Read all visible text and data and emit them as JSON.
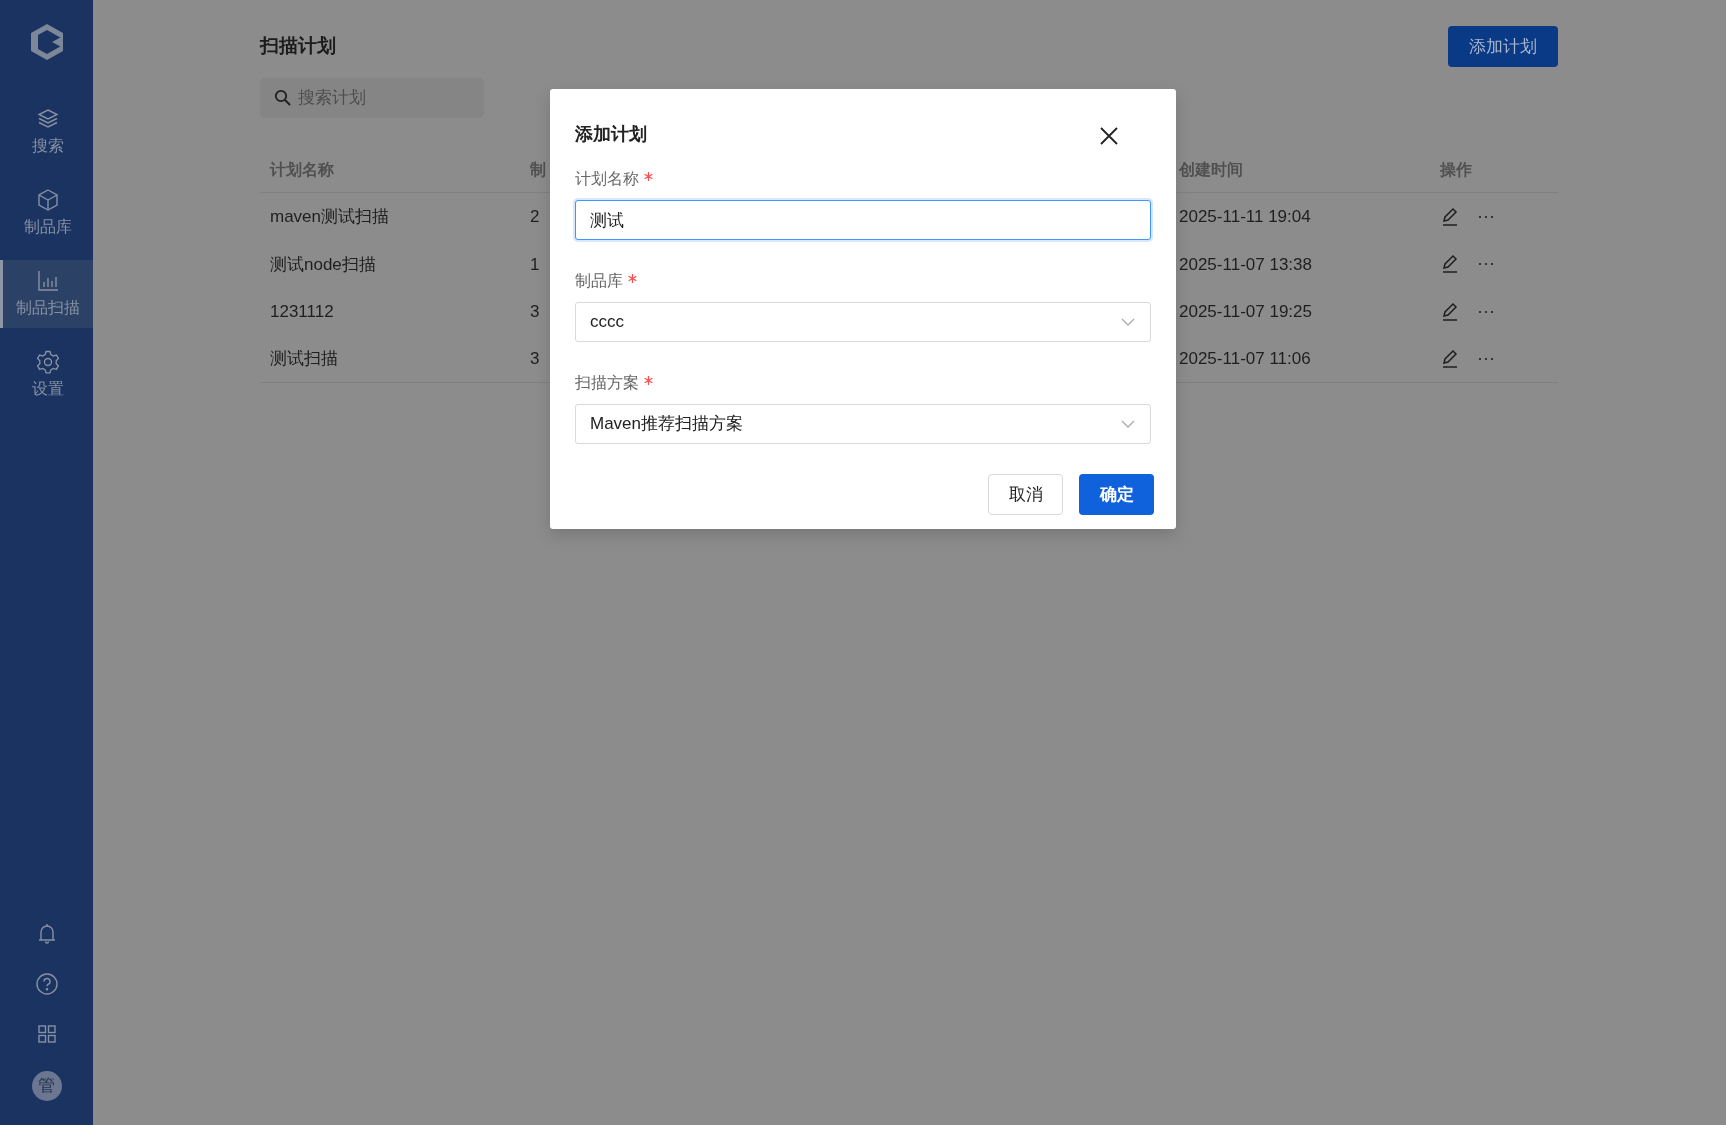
{
  "sidebar": {
    "items": [
      {
        "label": "搜索",
        "selected": false
      },
      {
        "label": "制品库",
        "selected": false
      },
      {
        "label": "制品扫描",
        "selected": true
      },
      {
        "label": "设置",
        "selected": false
      }
    ],
    "avatar": "管"
  },
  "page": {
    "title": "扫描计划",
    "add_button": "添加计划",
    "search": {
      "placeholder": "搜索计划"
    }
  },
  "table": {
    "columns": [
      "计划名称",
      "制",
      "创建时间",
      "操作"
    ],
    "rows": [
      {
        "name": "maven测试扫描",
        "column_2": "2",
        "created": "2025-11-11 19:04"
      },
      {
        "name": "测试node扫描",
        "column_2": "1",
        "created": "2025-11-07 13:38"
      },
      {
        "name": "1231112",
        "column_2": "3",
        "created": "2025-11-07 19:25"
      },
      {
        "name": "测试扫描",
        "column_2": "3",
        "created": "2025-11-07 11:06"
      }
    ]
  },
  "dialog": {
    "title": "添加计划",
    "fields": [
      {
        "kind": "input",
        "label": "计划名称",
        "required": true,
        "value": "测试",
        "focused": true
      },
      {
        "kind": "select",
        "label": "制品库",
        "required": true,
        "value": "cccc",
        "focused": false
      },
      {
        "kind": "select",
        "label": "扫描方案",
        "required": true,
        "value": "Maven推荐扫描方案",
        "focused": false
      }
    ],
    "buttons": [
      {
        "label": "取消",
        "primary": false
      },
      {
        "label": "确定",
        "primary": true
      }
    ]
  }
}
